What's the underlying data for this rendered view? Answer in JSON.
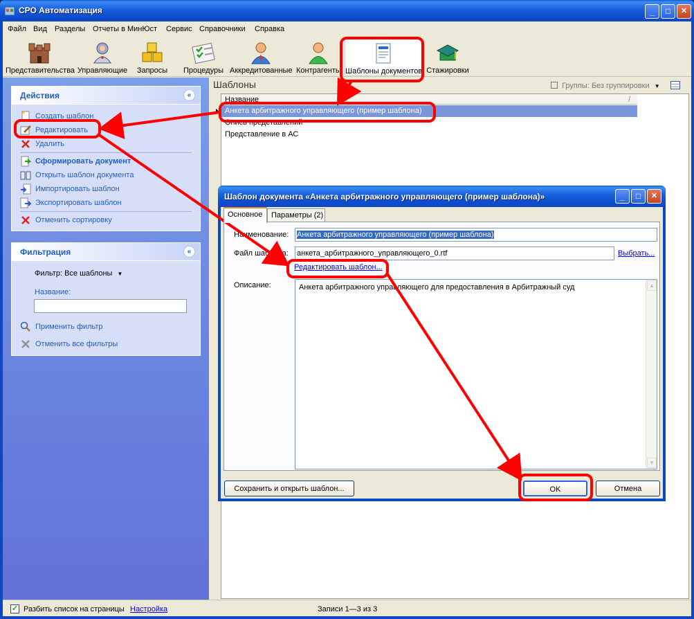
{
  "window": {
    "title": "СРО Автоматизация",
    "min": "_",
    "max": "□",
    "close": "✕"
  },
  "menu": [
    "Файл",
    "Вид",
    "Разделы",
    "Отчеты в МинЮст",
    "Сервис",
    "Справочники",
    "Справка"
  ],
  "toolbar": [
    {
      "label": "Представительства",
      "icon": "castle-icon"
    },
    {
      "label": "Управляющие",
      "icon": "manager-icon"
    },
    {
      "label": "Запросы",
      "icon": "blocks-icon"
    },
    {
      "label": "Процедуры",
      "icon": "checklist-icon"
    },
    {
      "label": "Аккредитованные",
      "icon": "person-tie-icon"
    },
    {
      "label": "Контрагенты",
      "icon": "person-green-icon"
    },
    {
      "label": "Шаблоны документов",
      "icon": "document-template-icon"
    },
    {
      "label": "Стажировки",
      "icon": "graduation-cap-icon"
    }
  ],
  "actions_panel": {
    "title": "Действия",
    "collapse": "«",
    "items": [
      {
        "label": "Создать шаблон",
        "icon": "new-document-icon"
      },
      {
        "label": "Редактировать",
        "icon": "edit-icon"
      },
      {
        "label": "Удалить",
        "icon": "delete-icon"
      },
      {
        "label": "Сформировать документ",
        "icon": "generate-document-icon"
      },
      {
        "label": "Открыть шаблон документа",
        "icon": "open-book-icon"
      },
      {
        "label": "Импортировать шаблон",
        "icon": "import-icon"
      },
      {
        "label": "Экспортировать шаблон",
        "icon": "export-icon"
      },
      {
        "label": "Отменить сортировку",
        "icon": "cancel-sort-icon"
      }
    ]
  },
  "filter_panel": {
    "title": "Фильтрация",
    "collapse": "«",
    "filter_label": "Фильтр: Все шаблоны",
    "name_label": "Название:",
    "name_value": "",
    "apply": "Применить фильтр",
    "clear": "Отменить все фильтры"
  },
  "content": {
    "header": "Шаблоны",
    "grouping": "Группы: Без группировки",
    "column": "Название",
    "rows": [
      "Анкета арбитражного управляющего (пример шаблона)",
      "Опись представлений",
      "Представление в АС"
    ],
    "selected_row": 0
  },
  "status": {
    "paginate": "Разбить список на страницы",
    "settings": "Настройка",
    "records": "Записи 1—3 из 3"
  },
  "dialog": {
    "title": "Шаблон документа «Анкета арбитражного управляющего (пример шаблона)»",
    "tabs": [
      "Основное",
      "Параметры (2)"
    ],
    "name_label": "Наименование:",
    "name_value": "Анкета арбитражного управляющего (пример шаблона)",
    "file_label": "Файл шаблона:",
    "file_value": "анкета_арбитражного_управляющего_0.rtf",
    "choose": "Выбрать...",
    "edit_template": "Редактировать шаблон...",
    "desc_label": "Описание:",
    "desc_value": "Анкета арбитражного управляющего для предоставления в Арбитражный суд",
    "save_open": "Сохранить и открыть шаблон...",
    "ok": "OK",
    "cancel": "Отмена"
  },
  "colors": {
    "xp_blue": "#0d48c4",
    "sidebar_link": "#215dc6",
    "selection": "#7b97dc",
    "annotation_red": "#ff0000"
  }
}
